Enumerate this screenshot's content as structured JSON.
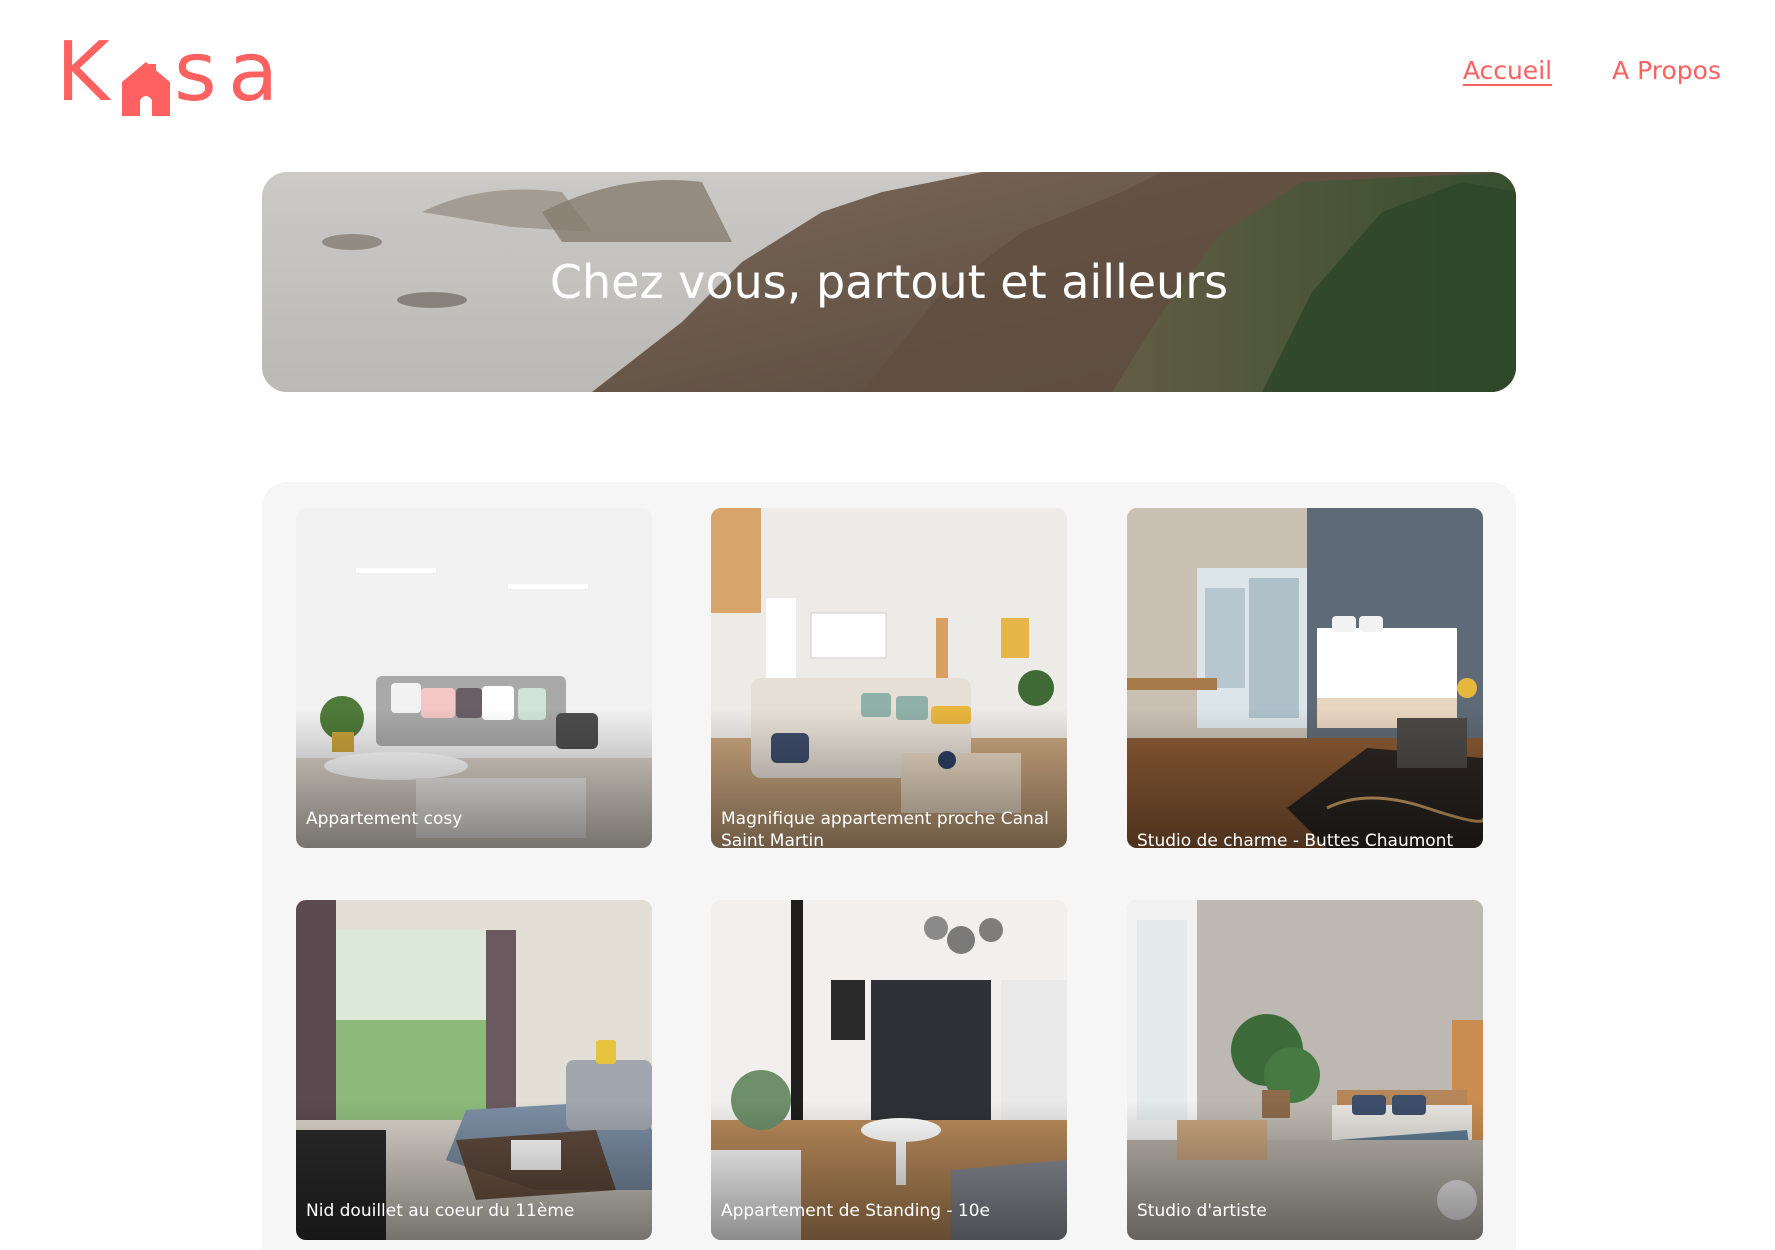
{
  "header": {
    "logo": {
      "letters": [
        "K",
        "s",
        "a"
      ],
      "icon": "house-icon",
      "color": "#FF6060"
    },
    "nav": [
      {
        "label": "Accueil",
        "active": true
      },
      {
        "label": "A Propos",
        "active": false
      }
    ]
  },
  "banner": {
    "title": "Chez vous, partout et ailleurs",
    "image": "coastal-cliffs-photo"
  },
  "listings": [
    {
      "title": "Appartement cosy",
      "image": "living-room-photo"
    },
    {
      "title": "Magnifique appartement proche Canal Saint Martin",
      "image": "living-room-sectional-photo"
    },
    {
      "title": "Studio de charme - Buttes Chaumont",
      "image": "hotel-bedroom-photo"
    },
    {
      "title": "Nid douillet au coeur du 11ème",
      "image": "living-room-window-photo"
    },
    {
      "title": "Appartement de Standing - 10e",
      "image": "kitchen-dining-photo"
    },
    {
      "title": "Studio d'artiste",
      "image": "loft-bedroom-photo"
    }
  ],
  "colors": {
    "accent": "#FF6060",
    "gallery_bg": "#F6F6F6",
    "text_on_image": "#FFFFFF"
  }
}
